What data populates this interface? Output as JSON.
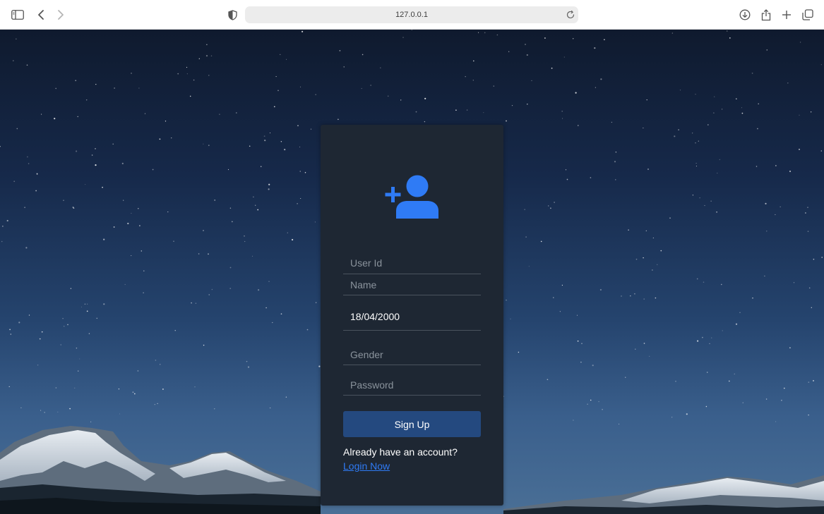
{
  "browser": {
    "url": "127.0.0.1",
    "icons": {
      "sidebar": "sidebar-icon",
      "back": "back-arrow-icon",
      "forward": "forward-arrow-icon",
      "privacy": "shield-icon",
      "reload": "reload-icon",
      "download": "download-icon",
      "share": "share-icon",
      "new_tab": "plus-icon",
      "tabs": "tab-overview-icon"
    }
  },
  "signup": {
    "icon": "user-plus-icon",
    "accent_color": "#2f7bf5",
    "card_color": "#1e2733",
    "button_color": "#24497f",
    "fields": {
      "user_id": {
        "placeholder": "User Id",
        "value": ""
      },
      "name": {
        "placeholder": "Name",
        "value": ""
      },
      "dob": {
        "value": "18/04/2000"
      },
      "gender": {
        "placeholder": "Gender",
        "value": ""
      },
      "password": {
        "placeholder": "Password",
        "value": ""
      }
    },
    "button_label": "Sign Up",
    "already_text": "Already have an account?",
    "login_link": "Login Now"
  }
}
